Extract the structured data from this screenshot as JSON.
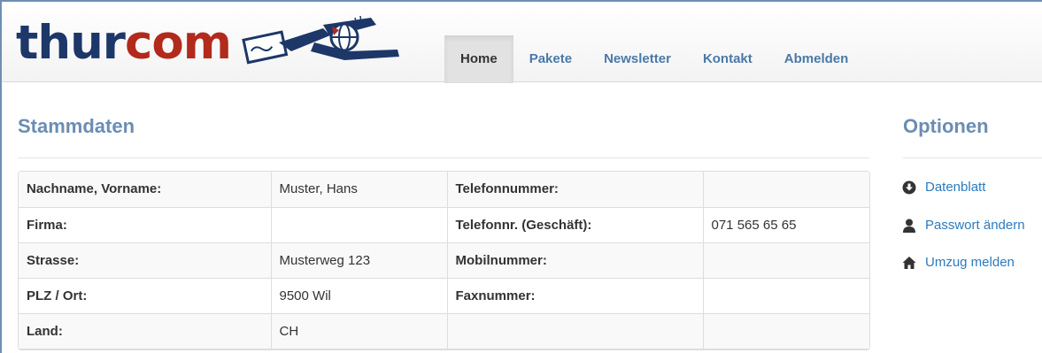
{
  "colors": {
    "brand_navy": "#1c3768",
    "brand_red": "#b22a1c",
    "heading": "#6b8db3",
    "link": "#2a7bbf",
    "nav_link": "#4a79a8",
    "icon": "#333333"
  },
  "logo": {
    "part1": "thur",
    "part2": "com",
    "art_icon": "mail-figure-icon"
  },
  "nav": {
    "items": [
      {
        "label": "Home",
        "active": true
      },
      {
        "label": "Pakete"
      },
      {
        "label": "Newsletter"
      },
      {
        "label": "Kontakt"
      },
      {
        "label": "Abmelden"
      }
    ]
  },
  "main": {
    "title": "Stammdaten",
    "rows": [
      {
        "label1": "Nachname, Vorname:",
        "value1": "Muster, Hans",
        "label2": "Telefonnummer:",
        "value2": ""
      },
      {
        "label1": "Firma:",
        "value1": "",
        "label2": "Telefonnr. (Geschäft):",
        "value2": "071 565 65 65"
      },
      {
        "label1": "Strasse:",
        "value1": "Musterweg 123",
        "label2": "Mobilnummer:",
        "value2": ""
      },
      {
        "label1": "PLZ / Ort:",
        "value1": "9500 Wil",
        "label2": "Faxnummer:",
        "value2": ""
      },
      {
        "label1": "Land:",
        "value1": "CH",
        "label2": "",
        "value2": ""
      }
    ]
  },
  "sidebar": {
    "title": "Optionen",
    "options": [
      {
        "label": "Datenblatt",
        "icon": "download-circle-icon"
      },
      {
        "label": "Passwort ändern",
        "icon": "user-icon"
      },
      {
        "label": "Umzug melden",
        "icon": "home-icon"
      }
    ]
  }
}
